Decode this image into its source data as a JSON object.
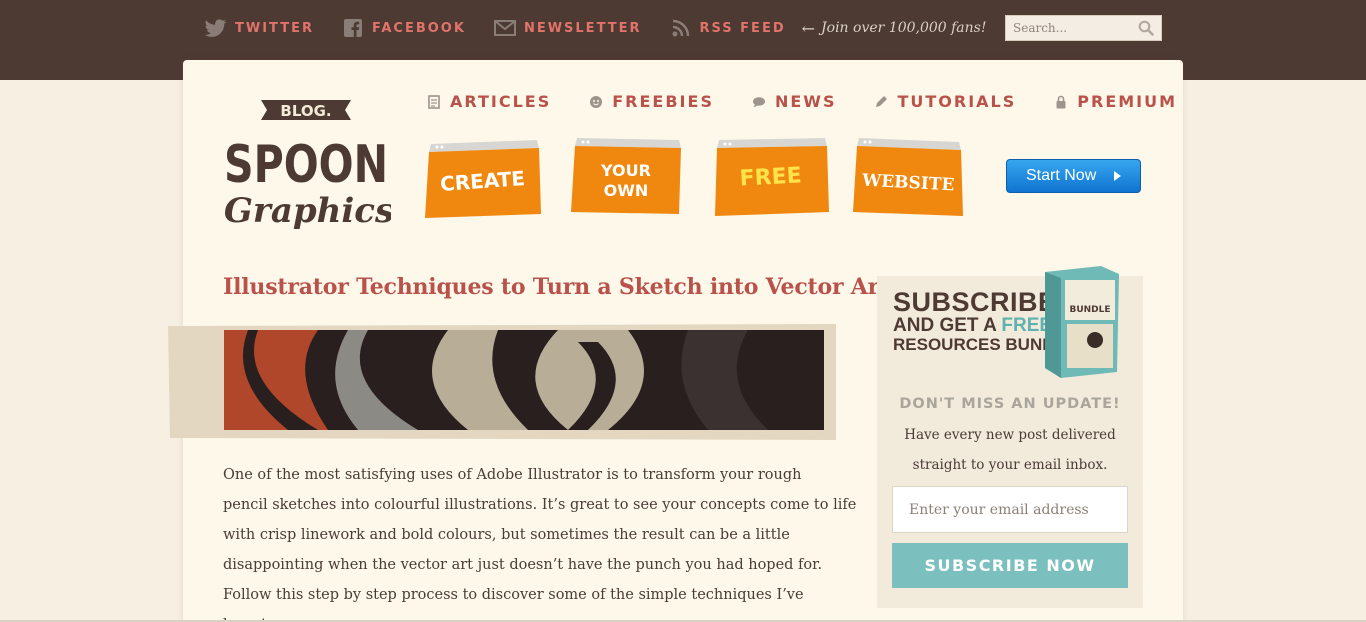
{
  "social": {
    "items": [
      {
        "label": "TWITTER",
        "icon": "twitter-icon"
      },
      {
        "label": "FACEBOOK",
        "icon": "facebook-icon"
      },
      {
        "label": "NEWSLETTER",
        "icon": "envelope-icon"
      },
      {
        "label": "RSS FEED",
        "icon": "rss-icon"
      }
    ],
    "fans_text": "Join over 100,000 fans!"
  },
  "search": {
    "placeholder": "Search..."
  },
  "logo": {
    "line1": "BLOG.",
    "line2": "SPOON",
    "line3": "Graphics"
  },
  "nav": {
    "items": [
      {
        "label": "ARTICLES",
        "icon": "document-icon"
      },
      {
        "label": "FREEBIES",
        "icon": "smiley-icon"
      },
      {
        "label": "NEWS",
        "icon": "speech-bubble-icon"
      },
      {
        "label": "TUTORIALS",
        "icon": "pencil-icon"
      },
      {
        "label": "PREMIUM",
        "icon": "lock-icon"
      }
    ]
  },
  "banner": {
    "windows": [
      "CREATE",
      "YOUR OWN",
      "FREE",
      "WEBSITE"
    ],
    "button_label": "Start Now",
    "colors": {
      "orange": "#f0870e",
      "button_blue": "#1a85dc"
    }
  },
  "article": {
    "title": "Illustrator Techniques to Turn a Sketch into Vector Art",
    "lines": [
      "One of the most satisfying uses of Adobe Illustrator is to transform your rough",
      "pencil sketches into colourful illustrations. It’s great to see your concepts come to life",
      "with crisp linework and bold colours, but sometimes the result can be a little",
      "disappointing when the vector art just doesn’t have the punch you had hoped for.",
      "Follow this step by step process to discover some of the simple techniques I’ve learnt"
    ]
  },
  "sidebar": {
    "head_l1": "SUBSCRIBE",
    "head_l2a": "AND GET A ",
    "head_l2b": "FREE!",
    "head_l3": "RESOURCES BUNDLE",
    "bundle_label": "BUNDLE",
    "dont_miss": "DON'T MISS AN UPDATE!",
    "desc_line1": "Have every new post delivered",
    "desc_line2": "straight to your email inbox.",
    "email_placeholder": "Enter your email address",
    "subscribe_label": "SUBSCRIBE NOW",
    "colors": {
      "teal": "#7bbfbf",
      "brand_red": "#b8524a"
    }
  }
}
